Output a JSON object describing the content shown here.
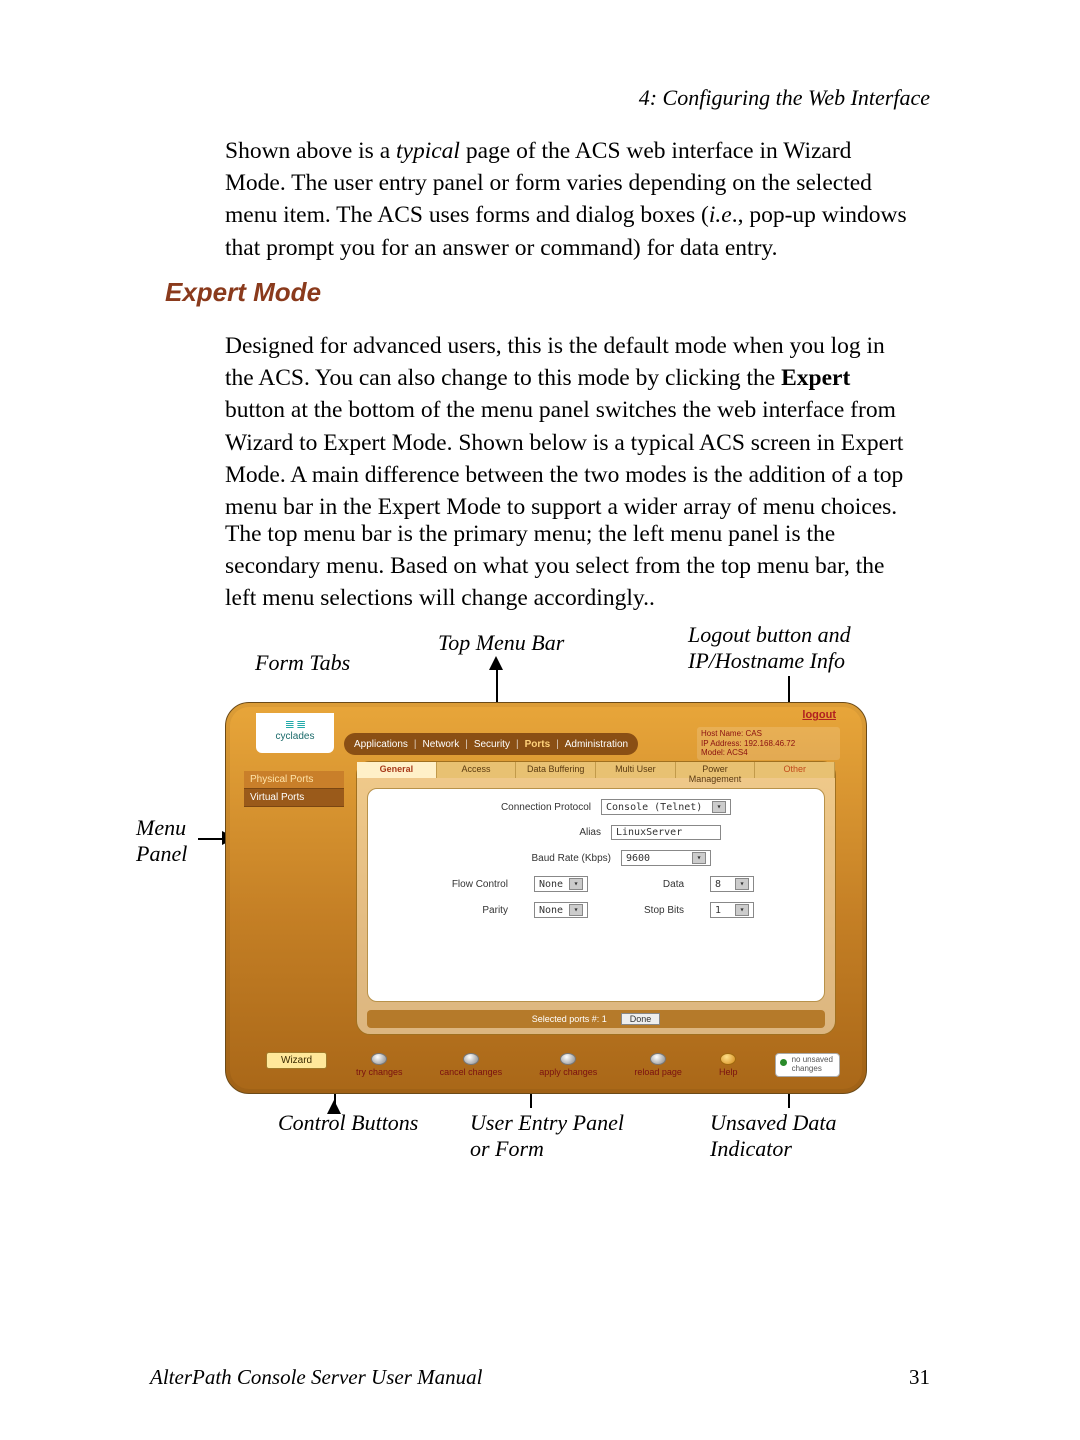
{
  "page_header": "4: Configuring the Web Interface",
  "para1_a": "Shown above is a ",
  "para1_b": "typical",
  "para1_c": " page of the ACS web interface in Wizard Mode. The user entry panel or form varies depending on the selected menu item. The ACS uses forms and dialog boxes (",
  "para1_d": "i.e",
  "para1_e": "., pop-up windows that prompt you for an answer or command) for data entry.",
  "heading": "Expert Mode",
  "para2_a": "Designed for advanced users, this is the default mode when you log in the ACS. You can also change to this mode by clicking the ",
  "para2_b": "Expert",
  "para2_c": " button at the bottom of the menu panel switches the web interface from Wizard to Expert Mode. Shown below is a typical ACS screen in Expert Mode. A main difference between the two modes is the addition of a top menu bar in the Expert Mode to support a wider array of menu choices.",
  "para3": "The top menu bar is the primary menu; the left menu panel is the secondary menu. Based on what you select from the top menu bar, the left menu selections will change accordingly..",
  "callouts": {
    "form_tabs": "Form Tabs",
    "top_menu": "Top Menu Bar",
    "logout_line1": "Logout button and",
    "logout_line2": "IP/Hostname Info",
    "menu_panel_line1": "Menu",
    "menu_panel_line2": "Panel",
    "control_buttons": "Control Buttons",
    "user_entry_line1": "User Entry Panel",
    "user_entry_line2": "or Form",
    "unsaved_line1": "Unsaved Data",
    "unsaved_line2": "Indicator"
  },
  "ui": {
    "brand": "cyclades",
    "logout": "logout",
    "host_l1": "Host Name: CAS",
    "host_l2": "IP Address: 192.168.46.72",
    "host_l3": "Model: ACS4",
    "topmenu": {
      "applications": "Applications",
      "network": "Network",
      "security": "Security",
      "ports": "Ports",
      "administration": "Administration"
    },
    "leftmenu": {
      "physical": "Physical Ports",
      "virtual": "Virtual Ports"
    },
    "tabs": {
      "general": "General",
      "access": "Access",
      "databuffering": "Data Buffering",
      "multiuser": "Multi User",
      "powermgmt": "Power Management",
      "other": "Other"
    },
    "fields": {
      "conn_proto_label": "Connection Protocol",
      "conn_proto_value": "Console (Telnet)",
      "alias_label": "Alias",
      "alias_value": "LinuxServer",
      "baud_label": "Baud Rate (Kbps)",
      "baud_value": "9600",
      "flow_label": "Flow Control",
      "flow_value": "None",
      "data_label": "Data",
      "data_value": "8",
      "parity_label": "Parity",
      "parity_value": "None",
      "stop_label": "Stop Bits",
      "stop_value": "1"
    },
    "status_selected": "Selected ports #: 1",
    "status_done": "Done",
    "wizard_btn": "Wizard",
    "ctrl": {
      "try": "try changes",
      "cancel": "cancel changes",
      "apply": "apply changes",
      "reload": "reload page",
      "help": "Help"
    },
    "unsaved_l1": "no unsaved",
    "unsaved_l2": "changes"
  },
  "footer_title": "AlterPath Console Server User Manual",
  "footer_page": "31"
}
